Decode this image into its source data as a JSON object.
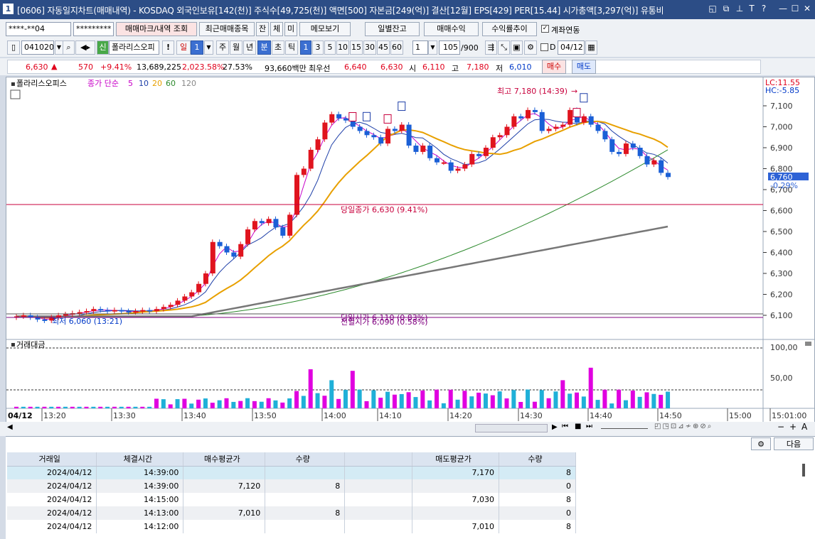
{
  "titlebar": {
    "number": "1",
    "title": "[0606] 자동일지차트(매매내역) - KOSDAQ 외국인보유[142(천)] 주식수[49,725(천)] 액면[500] 자본금[249(억)] 결산[12월] EPS[429] PER[15.44] 시가총액[3,297(억)] 유통비"
  },
  "toolbar1": {
    "account": "****-**04",
    "password": "*********",
    "btn_trade_mark": "매매마크/내역 조회",
    "btn_recent": "최근매매종목",
    "btn_jan": "잔",
    "btn_che": "체",
    "btn_mi": "미",
    "btn_memo": "메모보기",
    "btn_daily": "일별잔고",
    "btn_monthly": "매매수익",
    "btn_profit": "수익률추이",
    "chk_account_link": "계좌연동"
  },
  "toolbar2": {
    "code": "041020",
    "shin": "신",
    "stock_name": "폴라리스오피",
    "exclaim": "!",
    "period_day": "일",
    "period_num": "1",
    "btn_week": "주",
    "btn_month": "월",
    "btn_year": "년",
    "btn_min": "분",
    "btn_sec": "초",
    "btn_tick": "틱",
    "intervals": [
      "1",
      "3",
      "5",
      "10",
      "15",
      "30",
      "45",
      "60"
    ],
    "interval_num": "1",
    "count": "105",
    "count_total": "/900",
    "chk_d": "D",
    "date": "04/12"
  },
  "quote": {
    "price": "6,630",
    "arrow": "▲",
    "change": "570",
    "change_rate": "+9.41%",
    "volume": "13,689,225",
    "vol_rate": "2,023.58%",
    "turnover": "27.53%",
    "amount": "93,660백만",
    "pref_label": "최우선",
    "ask1": "6,640",
    "bid1": "6,630",
    "open_label": "시",
    "open": "6,110",
    "high_label": "고",
    "high": "7,180",
    "low_label": "저",
    "low": "6,010",
    "buy": "매수",
    "sell": "매도"
  },
  "chart": {
    "legend_name": "폴라리스오피스",
    "legend_ma_label": "종가 단순",
    "ma_periods": [
      "5",
      "10",
      "20",
      "60",
      "120"
    ],
    "lc": "LC:11.55",
    "hc": "HC:-5.85",
    "high_annot": "최고 7,180 (14:39)",
    "low_annot": "최저 6,060 (13:21)",
    "close_annot": "당일종가 6,630 (9.41%)",
    "open_annot": "당일시가 6,110 (0.83%)",
    "open_annot2": "전일시가 6,090 (0.58%)",
    "cur_price": "6,760",
    "cur_rate": "-0.29%",
    "yticks": [
      "7,100",
      "7,000",
      "6,900",
      "6,800",
      "6,700",
      "6,600",
      "6,500",
      "6,400",
      "6,300",
      "6,200",
      "6,100"
    ],
    "vol_label": "거래대금",
    "vol_ticks": [
      "100,00",
      "50,00"
    ],
    "date_label": "04/12",
    "xticks": [
      "13:20",
      "13:30",
      "13:40",
      "13:50",
      "14:00",
      "14:10",
      "14:20",
      "14:30",
      "14:40",
      "14:50",
      "15:00",
      "15:01:00"
    ]
  },
  "table": {
    "headers": [
      "거래일",
      "체결시간",
      "매수평균가",
      "수량",
      "",
      "매도평균가",
      "수량"
    ],
    "rows": [
      [
        "2024/04/12",
        "14:39:00",
        "",
        "",
        "",
        "7,170",
        "8"
      ],
      [
        "2024/04/12",
        "14:39:00",
        "7,120",
        "8",
        "",
        "",
        "0"
      ],
      [
        "2024/04/12",
        "14:15:00",
        "",
        "",
        "",
        "7,030",
        "8"
      ],
      [
        "2024/04/12",
        "14:13:00",
        "7,010",
        "8",
        "",
        "",
        "0"
      ],
      [
        "2024/04/12",
        "14:12:00",
        "",
        "",
        "",
        "7,010",
        "8"
      ]
    ],
    "next_btn": "다음"
  }
}
